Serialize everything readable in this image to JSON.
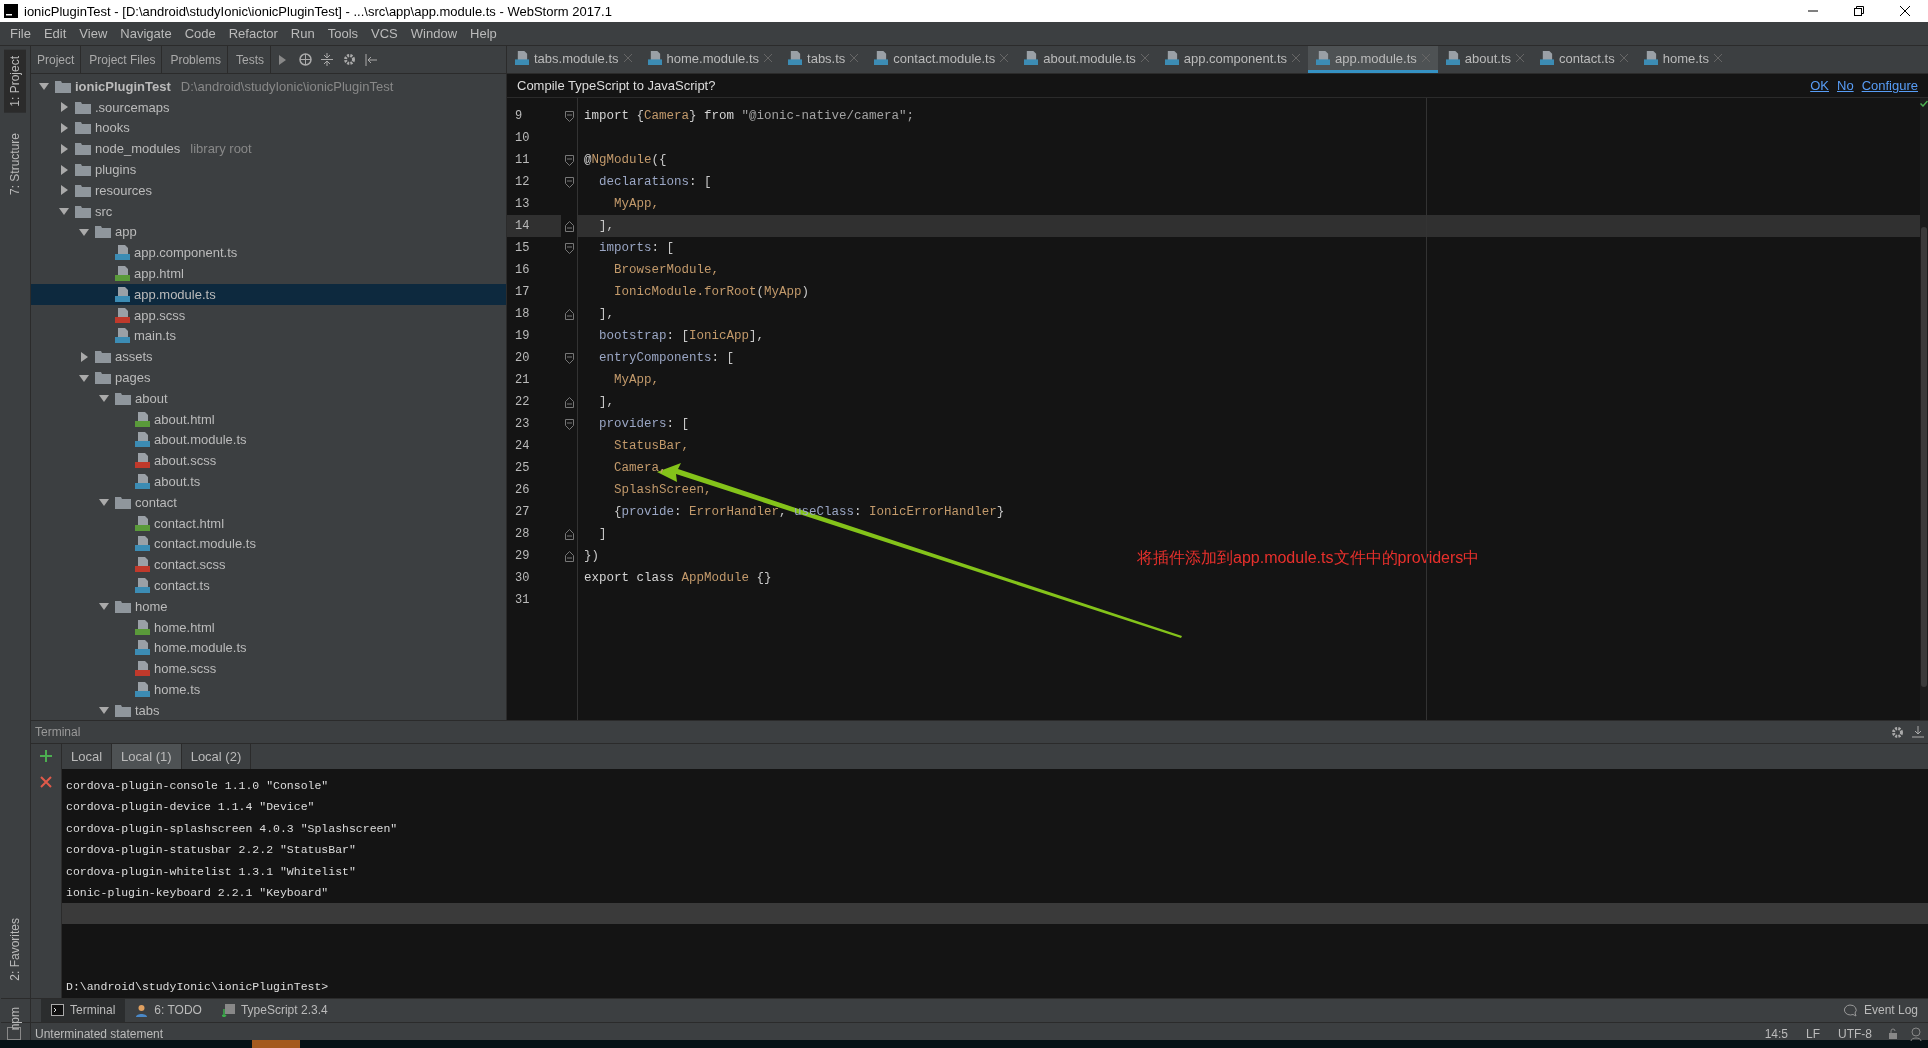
{
  "window": {
    "title": "ionicPluginTest - [D:\\android\\studyIonic\\ionicPluginTest] - ...\\src\\app\\app.module.ts - WebStorm 2017.1"
  },
  "menu": [
    "File",
    "Edit",
    "View",
    "Navigate",
    "Code",
    "Refactor",
    "Run",
    "Tools",
    "VCS",
    "Window",
    "Help"
  ],
  "side_strip": {
    "top": [
      {
        "label": "1: Project",
        "selected": true
      },
      {
        "label": "7: Structure",
        "selected": false
      }
    ],
    "bottom": [
      {
        "label": "2: Favorites",
        "selected": false
      },
      {
        "label": "npm",
        "selected": false
      }
    ]
  },
  "project_toolbar": [
    "Project",
    "Project Files",
    "Problems",
    "Tests"
  ],
  "editor_tabs": [
    {
      "label": "tabs.module.ts",
      "selected": false
    },
    {
      "label": "home.module.ts",
      "selected": false
    },
    {
      "label": "tabs.ts",
      "selected": false
    },
    {
      "label": "contact.module.ts",
      "selected": false
    },
    {
      "label": "about.module.ts",
      "selected": false
    },
    {
      "label": "app.component.ts",
      "selected": false
    },
    {
      "label": "app.module.ts",
      "selected": true
    },
    {
      "label": "about.ts",
      "selected": false
    },
    {
      "label": "contact.ts",
      "selected": false
    },
    {
      "label": "home.ts",
      "selected": false
    }
  ],
  "project_tree": [
    {
      "label": "ionicPluginTest",
      "note": "D:\\android\\studyIonic\\ionicPluginTest",
      "kind": "root",
      "expanded": true,
      "selected": false,
      "children": [
        {
          "label": ".sourcemaps",
          "kind": "folder",
          "expanded": false,
          "selected": false
        },
        {
          "label": "hooks",
          "kind": "folder",
          "expanded": false,
          "selected": false
        },
        {
          "label": "node_modules",
          "note": "library root",
          "kind": "folder",
          "expanded": false,
          "selected": false
        },
        {
          "label": "plugins",
          "kind": "folder",
          "expanded": false,
          "selected": false
        },
        {
          "label": "resources",
          "kind": "folder",
          "expanded": false,
          "selected": false
        },
        {
          "label": "src",
          "kind": "folder",
          "expanded": true,
          "selected": false,
          "children": [
            {
              "label": "app",
              "kind": "folder",
              "expanded": true,
              "selected": false,
              "children": [
                {
                  "label": "app.component.ts",
                  "kind": "ts",
                  "selected": false
                },
                {
                  "label": "app.html",
                  "kind": "html",
                  "selected": false
                },
                {
                  "label": "app.module.ts",
                  "kind": "ts",
                  "selected": true
                },
                {
                  "label": "app.scss",
                  "kind": "scss",
                  "selected": false
                },
                {
                  "label": "main.ts",
                  "kind": "ts",
                  "selected": false
                }
              ]
            },
            {
              "label": "assets",
              "kind": "folder",
              "expanded": false,
              "selected": false
            },
            {
              "label": "pages",
              "kind": "folder",
              "expanded": true,
              "selected": false,
              "children": [
                {
                  "label": "about",
                  "kind": "folder",
                  "expanded": true,
                  "selected": false,
                  "children": [
                    {
                      "label": "about.html",
                      "kind": "html",
                      "selected": false
                    },
                    {
                      "label": "about.module.ts",
                      "kind": "ts",
                      "selected": false
                    },
                    {
                      "label": "about.scss",
                      "kind": "scss",
                      "selected": false
                    },
                    {
                      "label": "about.ts",
                      "kind": "ts",
                      "selected": false
                    }
                  ]
                },
                {
                  "label": "contact",
                  "kind": "folder",
                  "expanded": true,
                  "selected": false,
                  "children": [
                    {
                      "label": "contact.html",
                      "kind": "html",
                      "selected": false
                    },
                    {
                      "label": "contact.module.ts",
                      "kind": "ts",
                      "selected": false
                    },
                    {
                      "label": "contact.scss",
                      "kind": "scss",
                      "selected": false
                    },
                    {
                      "label": "contact.ts",
                      "kind": "ts",
                      "selected": false
                    }
                  ]
                },
                {
                  "label": "home",
                  "kind": "folder",
                  "expanded": true,
                  "selected": false,
                  "children": [
                    {
                      "label": "home.html",
                      "kind": "html",
                      "selected": false
                    },
                    {
                      "label": "home.module.ts",
                      "kind": "ts",
                      "selected": false
                    },
                    {
                      "label": "home.scss",
                      "kind": "scss",
                      "selected": false
                    },
                    {
                      "label": "home.ts",
                      "kind": "ts",
                      "selected": false
                    }
                  ]
                },
                {
                  "label": "tabs",
                  "kind": "folder",
                  "expanded": true,
                  "selected": false
                }
              ]
            }
          ]
        }
      ]
    }
  ],
  "notification": {
    "text": "Compile TypeScript to JavaScript?",
    "actions": [
      "OK",
      "No",
      "Configure"
    ]
  },
  "code": [
    {
      "number": "9",
      "kind": "fold_start",
      "current": false,
      "tokens": [
        {
          "text": "import ",
          "kind": "kw"
        },
        {
          "text": "{",
          "kind": "plain"
        },
        {
          "text": "Camera",
          "kind": "ident"
        },
        {
          "text": "} ",
          "kind": "plain"
        },
        {
          "text": "from ",
          "kind": "kw"
        },
        {
          "text": "\"@ionic-native/camera\";",
          "kind": "str"
        }
      ]
    },
    {
      "number": "10",
      "kind": "plain",
      "current": false
    },
    {
      "number": "11",
      "kind": "fold_start",
      "current": false,
      "tokens": [
        {
          "text": "@",
          "kind": "kw"
        },
        {
          "text": "NgModule",
          "kind": "ident"
        },
        {
          "text": "({",
          "kind": "plain"
        }
      ]
    },
    {
      "number": "12",
      "kind": "fold_start",
      "current": false,
      "tokens": [
        {
          "text": "  declarations",
          "kind": "prop"
        },
        {
          "text": ": [",
          "kind": "plain"
        }
      ]
    },
    {
      "number": "13",
      "kind": "plain",
      "current": false,
      "tokens": [
        {
          "text": "    MyApp,",
          "kind": "ident"
        }
      ]
    },
    {
      "number": "14",
      "kind": "fold_end",
      "current": true,
      "tokens": [
        {
          "text": "  ],",
          "kind": "plain"
        }
      ]
    },
    {
      "number": "15",
      "kind": "fold_start",
      "current": false,
      "tokens": [
        {
          "text": "  imports",
          "kind": "prop"
        },
        {
          "text": ": [",
          "kind": "plain"
        }
      ]
    },
    {
      "number": "16",
      "kind": "plain",
      "current": false,
      "tokens": [
        {
          "text": "    BrowserModule,",
          "kind": "ident"
        }
      ]
    },
    {
      "number": "17",
      "kind": "plain",
      "current": false,
      "tokens": [
        {
          "text": "    IonicModule.forRoot",
          "kind": "ident"
        },
        {
          "text": "(",
          "kind": "plain"
        },
        {
          "text": "MyApp",
          "kind": "ident"
        },
        {
          "text": ")",
          "kind": "plain"
        }
      ]
    },
    {
      "number": "18",
      "kind": "fold_end",
      "current": false,
      "tokens": [
        {
          "text": "  ],",
          "kind": "plain"
        }
      ]
    },
    {
      "number": "19",
      "kind": "plain",
      "current": false,
      "tokens": [
        {
          "text": "  bootstrap",
          "kind": "prop"
        },
        {
          "text": ": [",
          "kind": "plain"
        },
        {
          "text": "IonicApp",
          "kind": "ident"
        },
        {
          "text": "],",
          "kind": "plain"
        }
      ]
    },
    {
      "number": "20",
      "kind": "fold_start",
      "current": false,
      "tokens": [
        {
          "text": "  entryComponents",
          "kind": "prop"
        },
        {
          "text": ": [",
          "kind": "plain"
        }
      ]
    },
    {
      "number": "21",
      "kind": "plain",
      "current": false,
      "tokens": [
        {
          "text": "    MyApp,",
          "kind": "ident"
        }
      ]
    },
    {
      "number": "22",
      "kind": "fold_end",
      "current": false,
      "tokens": [
        {
          "text": "  ],",
          "kind": "plain"
        }
      ]
    },
    {
      "number": "23",
      "kind": "fold_start",
      "current": false,
      "tokens": [
        {
          "text": "  providers",
          "kind": "prop"
        },
        {
          "text": ": [",
          "kind": "plain"
        }
      ]
    },
    {
      "number": "24",
      "kind": "plain",
      "current": false,
      "tokens": [
        {
          "text": "    StatusBar,",
          "kind": "ident"
        }
      ]
    },
    {
      "number": "25",
      "kind": "plain",
      "current": false,
      "tokens": [
        {
          "text": "    Camera,",
          "kind": "ident"
        }
      ]
    },
    {
      "number": "26",
      "kind": "plain",
      "current": false,
      "tokens": [
        {
          "text": "    SplashScreen,",
          "kind": "ident"
        }
      ]
    },
    {
      "number": "27",
      "kind": "plain",
      "current": false,
      "tokens": [
        {
          "text": "    {",
          "kind": "plain"
        },
        {
          "text": "provide",
          "kind": "prop"
        },
        {
          "text": ": ",
          "kind": "plain"
        },
        {
          "text": "ErrorHandler",
          "kind": "ident"
        },
        {
          "text": ", ",
          "kind": "plain"
        },
        {
          "text": "useClass",
          "kind": "prop"
        },
        {
          "text": ": ",
          "kind": "plain"
        },
        {
          "text": "IonicErrorHandler",
          "kind": "ident"
        },
        {
          "text": "}",
          "kind": "plain"
        }
      ]
    },
    {
      "number": "28",
      "kind": "fold_end",
      "current": false,
      "tokens": [
        {
          "text": "  ]",
          "kind": "plain"
        }
      ]
    },
    {
      "number": "29",
      "kind": "fold_end",
      "current": false,
      "tokens": [
        {
          "text": "})",
          "kind": "plain"
        }
      ]
    },
    {
      "number": "30",
      "kind": "plain",
      "current": false,
      "tokens": [
        {
          "text": "export class ",
          "kind": "kw"
        },
        {
          "text": "AppModule",
          "kind": "ident"
        },
        {
          "text": " {}",
          "kind": "plain"
        }
      ]
    },
    {
      "number": "31",
      "kind": "plain",
      "current": false
    }
  ],
  "annotation": {
    "text": "将插件添加到app.module.ts文件中的providers中"
  },
  "terminal": {
    "title": "Terminal",
    "tabs": [
      {
        "label": "Local",
        "selected": false
      },
      {
        "label": "Local (1)",
        "selected": true
      },
      {
        "label": "Local (2)",
        "selected": false
      }
    ],
    "lines": [
      "cordova-plugin-console 1.1.0 \"Console\"",
      "cordova-plugin-device 1.1.4 \"Device\"",
      "cordova-plugin-splashscreen 4.0.3 \"Splashscreen\"",
      "cordova-plugin-statusbar 2.2.2 \"StatusBar\"",
      "cordova-plugin-whitelist 1.3.1 \"Whitelist\"",
      "ionic-plugin-keyboard 2.2.1 \"Keyboard\""
    ],
    "prompt": "D:\\android\\studyIonic\\ionicPluginTest>"
  },
  "tool_tabs": [
    {
      "label": "Terminal",
      "kind": "terminal",
      "selected": true
    },
    {
      "label": "6: TODO",
      "kind": "todo",
      "selected": false
    },
    {
      "label": "TypeScript 2.3.4",
      "kind": "typescript",
      "selected": false
    }
  ],
  "event_log": "Event Log",
  "status": {
    "message": "Unterminated statement",
    "position": "14:5",
    "line_separator": "LF",
    "encoding": "UTF-8"
  }
}
